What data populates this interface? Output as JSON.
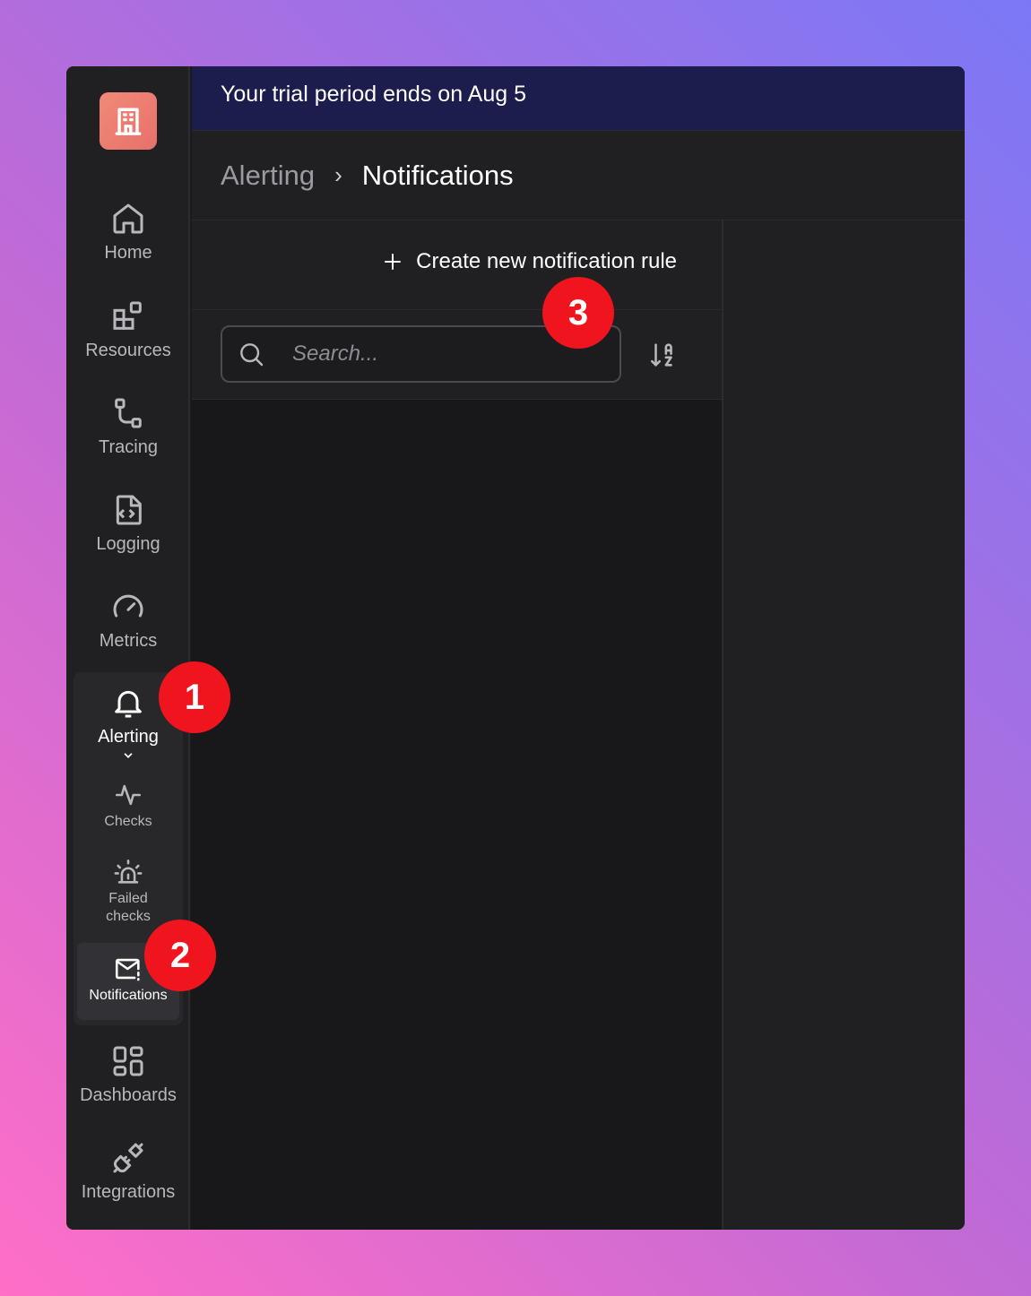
{
  "banner": {
    "trial_text": "Your trial period ends on Aug 5"
  },
  "breadcrumb": {
    "parent": "Alerting",
    "separator": "›",
    "current": "Notifications"
  },
  "sidebar": {
    "logo_icon": "building-icon",
    "items": [
      {
        "label": "Home",
        "icon": "home-icon"
      },
      {
        "label": "Resources",
        "icon": "resources-icon"
      },
      {
        "label": "Tracing",
        "icon": "tracing-icon"
      },
      {
        "label": "Logging",
        "icon": "logging-icon"
      },
      {
        "label": "Metrics",
        "icon": "gauge-icon"
      },
      {
        "label": "Alerting",
        "icon": "bell-icon",
        "expanded": true
      },
      {
        "label": "Dashboards",
        "icon": "dashboards-icon"
      },
      {
        "label": "Integrations",
        "icon": "plug-icon"
      }
    ],
    "alerting_subitems": [
      {
        "label": "Checks",
        "icon": "activity-icon"
      },
      {
        "label": "Failed checks",
        "icon": "siren-icon"
      },
      {
        "label": "Notifications",
        "icon": "mail-alert-icon",
        "active": true
      }
    ]
  },
  "toolbar": {
    "create_label": "Create new notification rule",
    "search_placeholder": "Search...",
    "sort_icon": "sort-a-z-icon"
  },
  "annotations": {
    "badge1": "1",
    "badge2": "2",
    "badge3": "3"
  },
  "colors": {
    "accent_badge": "#f0141e",
    "banner_bg": "#1d1d4d",
    "logo_gradient_start": "#f08a78",
    "logo_gradient_end": "#e8706a"
  }
}
